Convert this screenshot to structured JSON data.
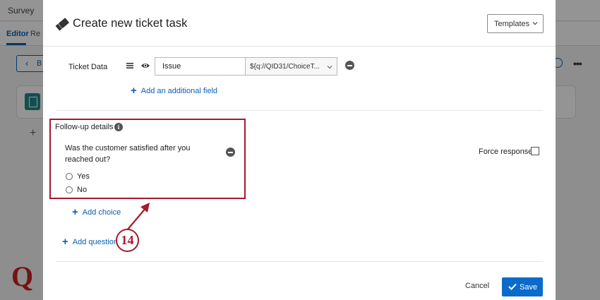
{
  "background": {
    "breadcrumb": "Survey",
    "tabs": [
      {
        "label": "Editor",
        "active": true
      },
      {
        "label": "Re",
        "active": false
      }
    ],
    "back_button_label": "B",
    "overflow_icon": "more-horizontal-icon",
    "logo_letter": "Q"
  },
  "modal": {
    "title": "Create new ticket task",
    "title_icon": "ticket-icon",
    "templates_button": "Templates",
    "ticket_data": {
      "label": "Ticket Data",
      "field_name": "Issue",
      "field_value": "${q://QID31/ChoiceT...",
      "add_field_link": "Add an additional field"
    },
    "followup": {
      "label": "Follow-up details",
      "question": "Was the customer satisfied after you reached out?",
      "choices": [
        "Yes",
        "No"
      ],
      "add_choice_link": "Add choice",
      "add_question_link": "Add question",
      "force_response_label": "Force response",
      "force_response_checked": false
    },
    "footer": {
      "cancel_label": "Cancel",
      "save_label": "Save"
    }
  },
  "annotation": {
    "step_number": "14",
    "color": "#a6192e"
  },
  "colors": {
    "accent": "#0b6bcb",
    "link": "#0b5fb3",
    "annotation": "#a6192e"
  }
}
